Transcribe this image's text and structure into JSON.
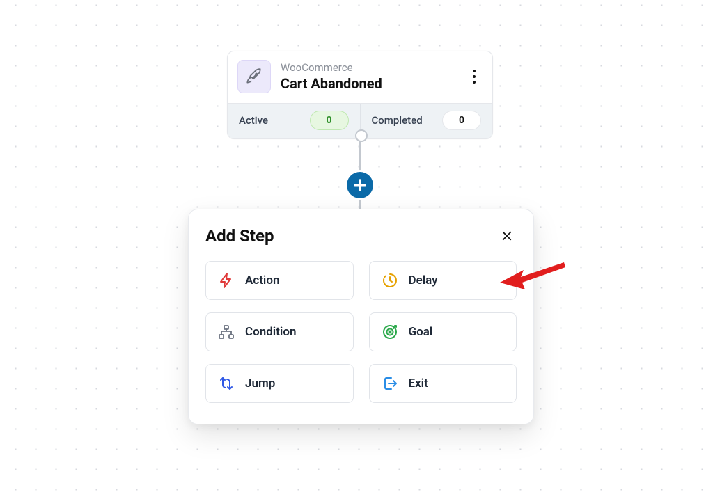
{
  "trigger": {
    "source": "WooCommerce",
    "title": "Cart Abandoned",
    "icon_name": "rocket-icon",
    "stats": {
      "active_label": "Active",
      "active_count": "0",
      "completed_label": "Completed",
      "completed_count": "0"
    }
  },
  "popover": {
    "title": "Add Step",
    "steps": [
      {
        "key": "action",
        "label": "Action",
        "icon": "bolt-icon",
        "color": "#e03a3a"
      },
      {
        "key": "delay",
        "label": "Delay",
        "icon": "clock-icon",
        "color": "#e6a100"
      },
      {
        "key": "condition",
        "label": "Condition",
        "icon": "branch-icon",
        "color": "#6b7280"
      },
      {
        "key": "goal",
        "label": "Goal",
        "icon": "target-icon",
        "color": "#2aa84a"
      },
      {
        "key": "jump",
        "label": "Jump",
        "icon": "jump-icon",
        "color": "#2f58e6"
      },
      {
        "key": "exit",
        "label": "Exit",
        "icon": "exit-icon",
        "color": "#2a8de6"
      }
    ]
  },
  "colors": {
    "plus_bg": "#0b6aa8",
    "pill_green_text": "#2f8f2a"
  }
}
